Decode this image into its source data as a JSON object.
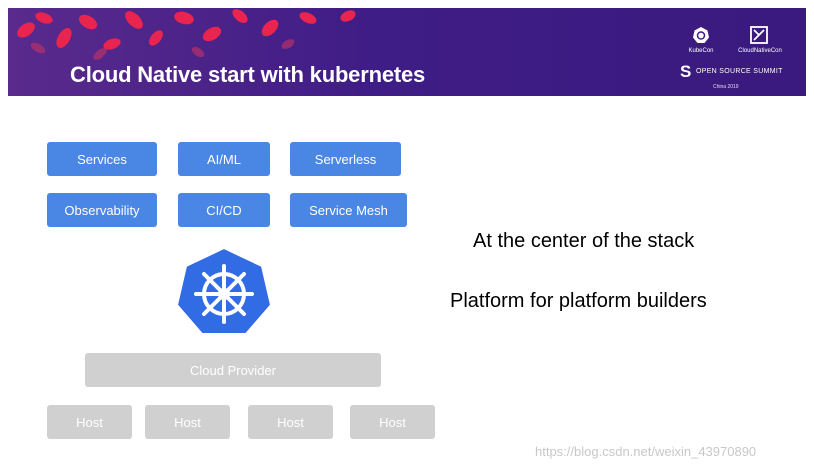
{
  "banner": {
    "title": "Cloud Native start with kubernetes",
    "logos": {
      "kubecon": "KubeCon",
      "cloudnativecon": "CloudNativeCon",
      "open_source_summit": "OPEN SOURCE SUMMIT",
      "region": "China 2019"
    }
  },
  "stack": {
    "row1": [
      "Services",
      "AI/ML",
      "Serverless"
    ],
    "row2": [
      "Observability",
      "CI/CD",
      "Service Mesh"
    ],
    "cloud_provider": "Cloud Provider",
    "hosts": [
      "Host",
      "Host",
      "Host",
      "Host"
    ]
  },
  "statements": [
    "At the center of the stack",
    "Platform for platform builders"
  ],
  "watermark": "https://blog.csdn.net/weixin_43970890",
  "colors": {
    "banner": "#3f1d86",
    "leaves": "#e8244f",
    "layer_blue": "#4a86e4",
    "layer_gray": "#d0d0d0",
    "k8s_blue": "#326ce5"
  },
  "icons": [
    "leaves-decoration",
    "kubecon-icon",
    "cloudnativecon-icon",
    "kubernetes-helm-icon"
  ]
}
